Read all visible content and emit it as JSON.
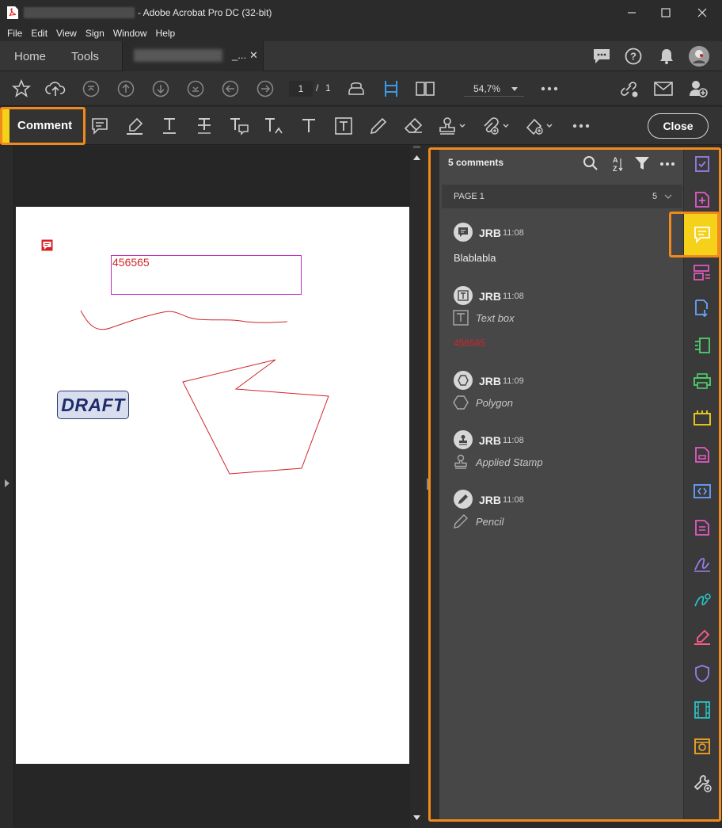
{
  "window": {
    "title": "- Adobe Acrobat Pro DC (32-bit)"
  },
  "menu": [
    "File",
    "Edit",
    "View",
    "Sign",
    "Window",
    "Help"
  ],
  "tabs": {
    "home": "Home",
    "tools": "Tools",
    "document_suffix": "_..."
  },
  "toolbar": {
    "page_current": "1",
    "page_separator": "/",
    "page_total": "1",
    "zoom": "54,7%"
  },
  "comment_toolbar": {
    "label": "Comment",
    "close_label": "Close"
  },
  "document": {
    "textbox_content": "456565",
    "stamp_text": "DRAFT"
  },
  "panel": {
    "count_label": "5 comments",
    "page_group_label": "PAGE 1",
    "page_group_count": "5",
    "comments": [
      {
        "author": "JRB",
        "time": "11:08",
        "body": "Blablabla",
        "type": ""
      },
      {
        "author": "JRB",
        "time": "11:08",
        "type": "Text box",
        "body": "456565"
      },
      {
        "author": "JRB",
        "time": "11:09",
        "type": "Polygon",
        "body": ""
      },
      {
        "author": "JRB",
        "time": "11:08",
        "type": "Applied Stamp",
        "body": ""
      },
      {
        "author": "JRB",
        "time": "11:08",
        "type": "Pencil",
        "body": ""
      }
    ]
  },
  "colors": {
    "accent_orange": "#f08a1c",
    "active_yellow": "#f5d219",
    "annotation_red": "#d0262c",
    "textbox_border": "#c22ac2"
  },
  "right_rail_icons": [
    "fill-sign-icon",
    "create-pdf-icon",
    "comment-icon",
    "organize-pages-icon",
    "export-pdf-icon",
    "edit-pdf-icon",
    "print-production-icon",
    "combine-files-icon",
    "create-form-icon",
    "javascript-icon",
    "rich-media-icon",
    "fill-and-sign-icon",
    "request-signature-icon",
    "redact-icon",
    "protect-icon",
    "media-icon",
    "action-wizard-icon",
    "more-tools-icon"
  ]
}
